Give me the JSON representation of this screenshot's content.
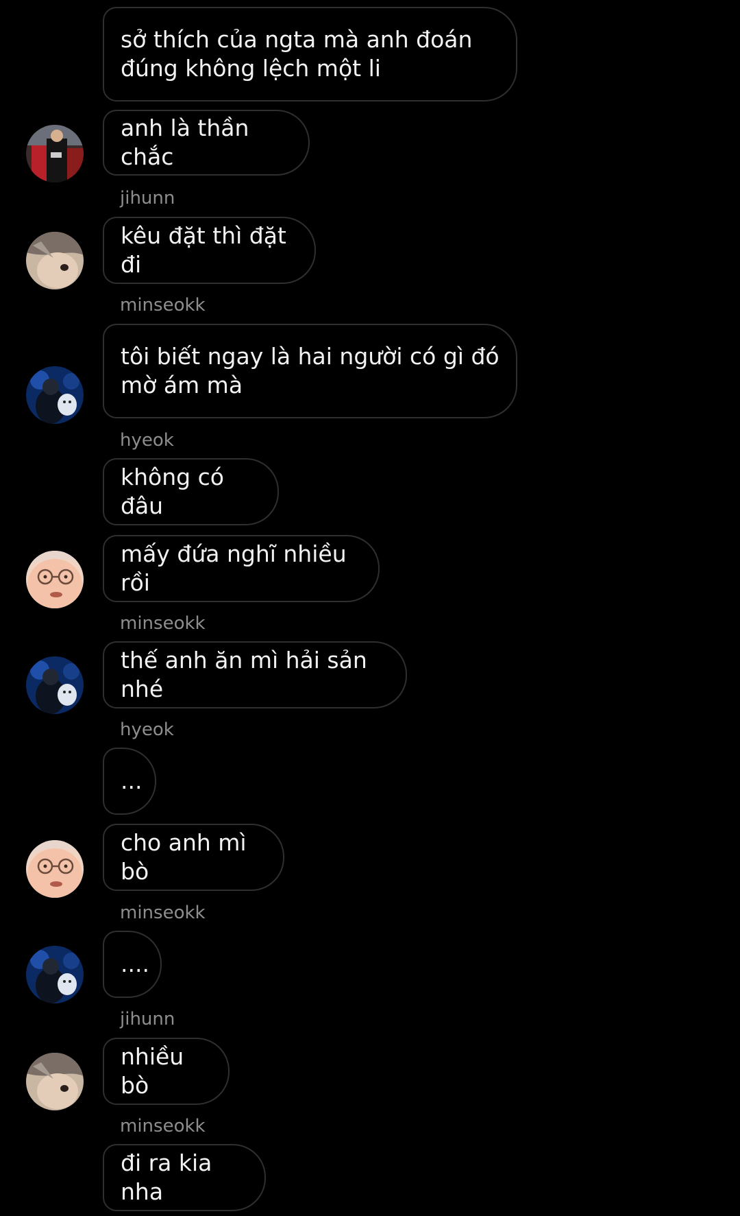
{
  "messages": [
    {
      "text": "sở thích của ngta mà anh đoán\nđúng không lệch một li"
    },
    {
      "text": "anh là thần chắc",
      "avatar": "user-avatar-red-shirt"
    },
    {
      "sender": "jihunn",
      "text": "kêu đặt thì đặt đi",
      "avatar": "user-avatar-jihunn"
    },
    {
      "sender": "minseokk",
      "text": "tôi biết ngay là hai người có gì đó\nmờ ám mà",
      "avatar": "user-avatar-minseokk"
    },
    {
      "sender": "hyeok",
      "text": "không có đâu"
    },
    {
      "text": "mấy đứa nghĩ nhiều rồi",
      "avatar": "user-avatar-hyeok"
    },
    {
      "sender": "minseokk",
      "text": "thế anh ăn mì hải sản nhé",
      "avatar": "user-avatar-minseokk"
    },
    {
      "sender": "hyeok",
      "text": "..."
    },
    {
      "text": "cho anh mì bò",
      "avatar": "user-avatar-hyeok"
    },
    {
      "sender": "minseokk",
      "text": "....",
      "avatar": "user-avatar-minseokk"
    },
    {
      "sender": "jihunn",
      "text": "nhiều bò",
      "avatar": "user-avatar-jihunn"
    },
    {
      "sender": "minseokk",
      "text": "đi ra kia nha"
    }
  ],
  "colors": {
    "background": "#000000",
    "bubble_border": "#2f2f2f",
    "message_text": "#f2f2f2",
    "sender_text": "#8e8e8e"
  }
}
